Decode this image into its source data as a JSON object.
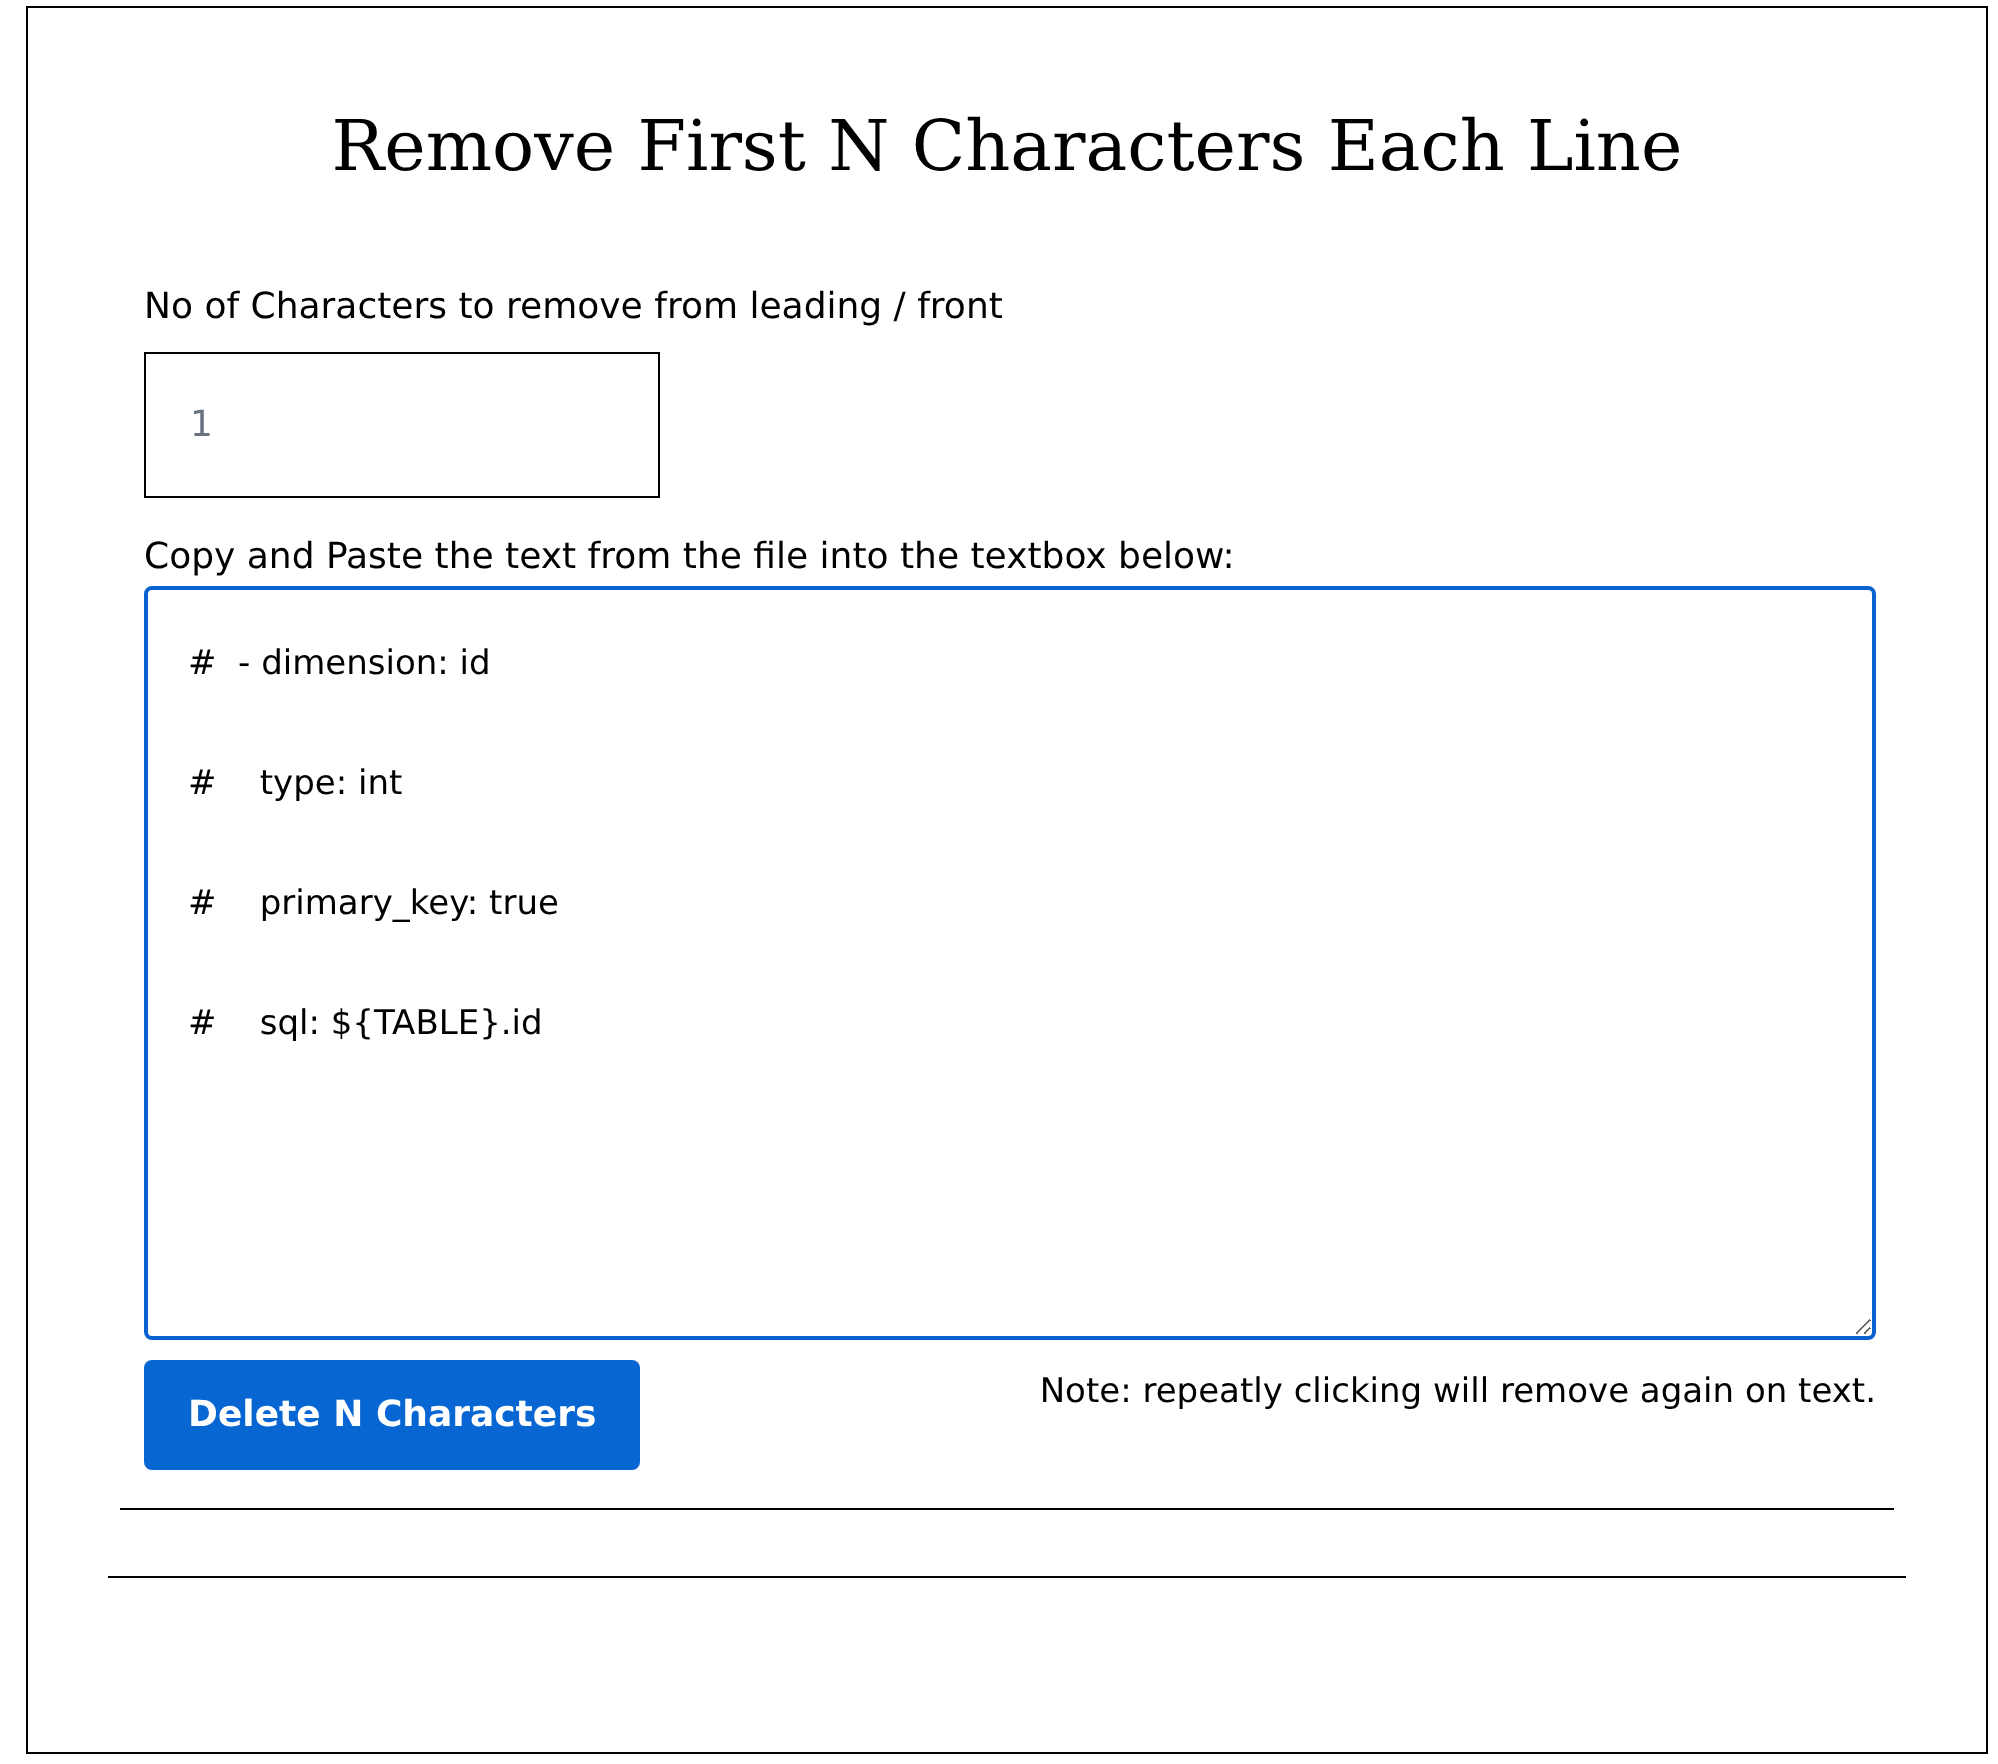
{
  "title": "Remove First N Characters Each Line",
  "count_field": {
    "label": "No of Characters to remove from leading / front",
    "placeholder": "1"
  },
  "text_area": {
    "label": "Copy and Paste the text from the file into the textbox below:",
    "focused": true,
    "lines": [
      "#  - dimension: id",
      "#    type: int",
      "#    primary_key: true",
      "#    sql: ${TABLE}.id"
    ]
  },
  "button": "Delete N Characters",
  "note": "Note: repeatly clicking will remove again on text."
}
